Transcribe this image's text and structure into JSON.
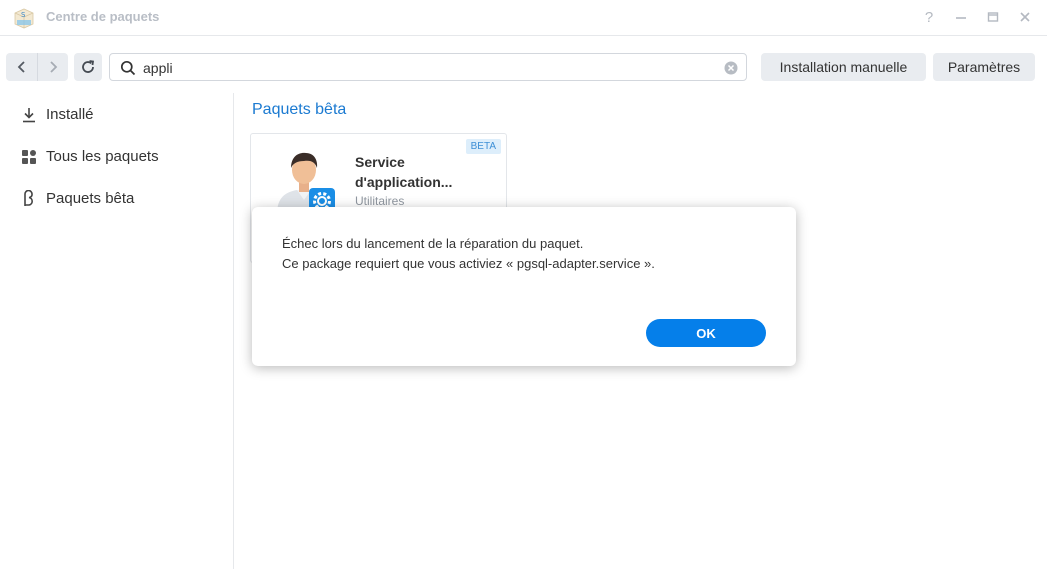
{
  "window": {
    "title": "Centre de paquets",
    "app_icon": "package-center-icon",
    "controls": {
      "help": "?",
      "minimize": "—",
      "maximize": "▭",
      "close": "✕"
    }
  },
  "toolbar": {
    "back_icon": "chevron-left-icon",
    "forward_icon": "chevron-right-icon",
    "refresh_icon": "refresh-icon",
    "search": {
      "value": "appli",
      "placeholder": ""
    },
    "install_manual_label": "Installation manuelle",
    "settings_label": "Paramètres"
  },
  "sidebar": {
    "items": [
      {
        "label": "Installé",
        "icon": "download-icon"
      },
      {
        "label": "Tous les paquets",
        "icon": "grid-icon"
      },
      {
        "label": "Paquets bêta",
        "icon": "beta-icon"
      }
    ]
  },
  "main": {
    "section_title": "Paquets bêta",
    "packages": [
      {
        "name_line1": "Service",
        "name_line2": "d'application...",
        "category": "Utilitaires",
        "badge": "BETA"
      }
    ]
  },
  "dialog": {
    "line1": "Échec lors du lancement de la réparation du paquet.",
    "line2": "Ce package requiert que vous activiez « pgsql-adapter.service ».",
    "ok_label": "OK"
  },
  "colors": {
    "accent": "#057fea",
    "section_title": "#1b7ad1",
    "button_bg": "#e9ecf0",
    "badge_bg": "#ddeefb"
  }
}
